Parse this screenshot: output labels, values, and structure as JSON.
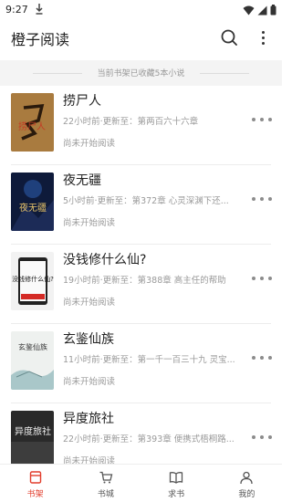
{
  "status_bar": {
    "time": "9:27"
  },
  "app_bar": {
    "title": "橙子阅读"
  },
  "shelf": {
    "summary": "当前书架已收藏5本小说"
  },
  "books": [
    {
      "title": "捞尸人",
      "update": "22小时前·更新至：第两百六十六章",
      "status": "尚未开始阅读",
      "cover_text": "捞尸人"
    },
    {
      "title": "夜无疆",
      "update": "5小时前·更新至：第372章 心灵深渊下还...",
      "status": "尚未开始阅读",
      "cover_text": "夜无疆"
    },
    {
      "title": "没钱修什么仙?",
      "update": "19小时前·更新至：第388章 高主任的帮助",
      "status": "尚未开始阅读",
      "cover_text": "没钱修什么仙?"
    },
    {
      "title": "玄鉴仙族",
      "update": "11小时前·更新至：第一千一百三十九 灵宝...",
      "status": "尚未开始阅读",
      "cover_text": "玄鉴仙族"
    },
    {
      "title": "异度旅社",
      "update": "22小时前·更新至：第393章 便携式梧桐路...",
      "status": "尚未开始阅读",
      "cover_text": "异度旅社"
    }
  ],
  "tabs": [
    {
      "label": "书架",
      "active": true
    },
    {
      "label": "书城",
      "active": false
    },
    {
      "label": "求书",
      "active": false
    },
    {
      "label": "我的",
      "active": false
    }
  ],
  "colors": {
    "accent": "#e23d2c",
    "muted_text": "#9a9a9a",
    "banner_bg": "#f4f4f4"
  }
}
